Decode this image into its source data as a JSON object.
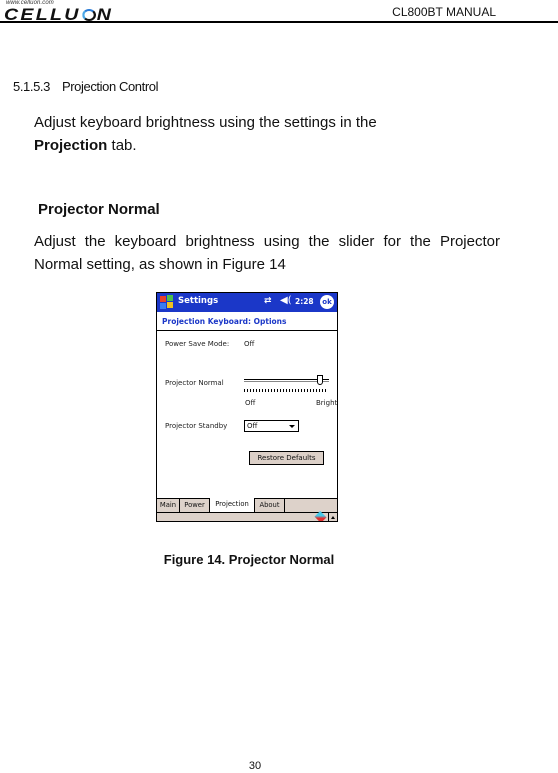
{
  "header": {
    "logo_url": "www.celluon.com",
    "logo_text_1": "CELLU",
    "logo_text_2": "N",
    "manual_title": "CL800BT MANUAL"
  },
  "section": {
    "number": "5.1.5.3",
    "title": "Projection Control",
    "intro_text": "Adjust keyboard brightness using the settings in the",
    "intro_bold": "Projection",
    "intro_tail": " tab."
  },
  "subsection": {
    "title": "Projector Normal",
    "text": "Adjust the keyboard brightness using the slider for the Projector Normal setting, as shown in Figure 14"
  },
  "figure": {
    "caption": "Figure 14. Projector Normal",
    "device": {
      "app_title": "Settings",
      "sync_icon": "⇄",
      "volume_icon": "◀(",
      "clock": "2:28",
      "ok_label": "ok",
      "page_subtitle": "Projection Keyboard: Options",
      "power_save_label": "Power Save Mode:",
      "power_save_value": "Off",
      "projector_normal_label": "Projector Normal",
      "slider_value_fraction": 0.92,
      "slider_min_label": "Off",
      "slider_max_label": "Bright",
      "projector_standby_label": "Projector Standby",
      "projector_standby_value": "Off",
      "restore_button": "Restore Defaults",
      "tabs": [
        {
          "label": "Main",
          "active": false
        },
        {
          "label": "Power",
          "active": false
        },
        {
          "label": "Projection",
          "active": true
        },
        {
          "label": "About",
          "active": false
        }
      ],
      "colors": {
        "titlebar": "#1b37c8",
        "bar_bg": "#ddd2ca"
      }
    }
  },
  "footer": {
    "page_number": "30"
  }
}
